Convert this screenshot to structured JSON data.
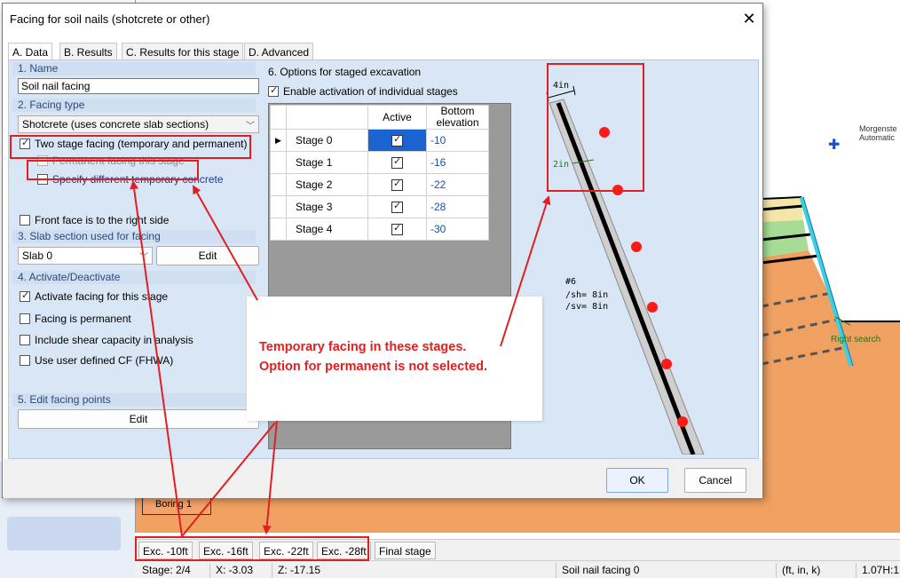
{
  "dialog": {
    "title": "Facing for soil nails (shotcrete or other)",
    "close_glyph": "✕",
    "tabs": [
      "A. Data",
      "B. Results",
      "C. Results for this stage",
      "D. Advanced"
    ],
    "ok_label": "OK",
    "cancel_label": "Cancel"
  },
  "left": {
    "name_section": "1. Name",
    "name_value": "Soil nail facing",
    "facing_type_section": "2. Facing type",
    "facing_type_value": "Shotcrete (uses concrete slab sections)",
    "two_stage_label": "Two stage facing (temporary and permanent)",
    "two_stage_checked": true,
    "permanent_this_stage_label": "Permanent facing this stage",
    "permanent_this_stage_checked": false,
    "specify_temp_label": "Specify different temporary concrete",
    "specify_temp_checked": false,
    "front_face_label": "Front face is to the right side",
    "front_face_checked": false,
    "slab_section": "3. Slab section used for facing",
    "slab_value": "Slab 0",
    "slab_edit_label": "Edit",
    "activate_section": "4. Activate/Deactivate",
    "activate_label": "Activate facing for this stage",
    "activate_checked": true,
    "is_permanent_label": "Facing is permanent",
    "is_permanent_checked": false,
    "shear_label": "Include shear capacity in analysis",
    "shear_checked": false,
    "user_cf_label": "Use user defined CF (FHWA)",
    "user_cf_checked": false,
    "edit_points_section": "5. Edit facing points",
    "edit_points_button": "Edit"
  },
  "staged": {
    "section": "6. Options for staged excavation",
    "enable_label": "Enable activation of individual stages",
    "enable_checked": true,
    "col_active": "Active",
    "col_bottom": "Bottom elevation",
    "rows": [
      {
        "name": "Stage 0",
        "active": true,
        "elevation": "-10",
        "current": true
      },
      {
        "name": "Stage 1",
        "active": true,
        "elevation": "-16",
        "current": false
      },
      {
        "name": "Stage 2",
        "active": true,
        "elevation": "-22",
        "current": false
      },
      {
        "name": "Stage 3",
        "active": true,
        "elevation": "-28",
        "current": false
      },
      {
        "name": "Stage 4",
        "active": true,
        "elevation": "-30",
        "current": false
      }
    ]
  },
  "preview": {
    "thickness_top": "4in",
    "cover": "2in",
    "bar_label_1": "#6",
    "bar_label_2": "/sh= 8in",
    "bar_label_3": "/sv= 8in"
  },
  "annotation": {
    "line1": "Temporary facing in these stages.",
    "line2": "Option for permanent is not selected.",
    "color": "#e02020"
  },
  "background": {
    "morgenstern_1": "Morgenste",
    "morgenstern_2": "Automatic",
    "right_search": "Right search",
    "boring": "Boring 1",
    "tabs": [
      "Exc. -10ft",
      "Exc. -16ft",
      "Exc. -22ft",
      "Exc. -28ft",
      "Final stage"
    ],
    "status": {
      "stage": "Stage: 2/4",
      "x": "X: -3.03",
      "z": "Z: -17.15",
      "object": "Soil nail facing 0",
      "units": "(ft, in, k)",
      "scale": "1.07H:1"
    }
  }
}
